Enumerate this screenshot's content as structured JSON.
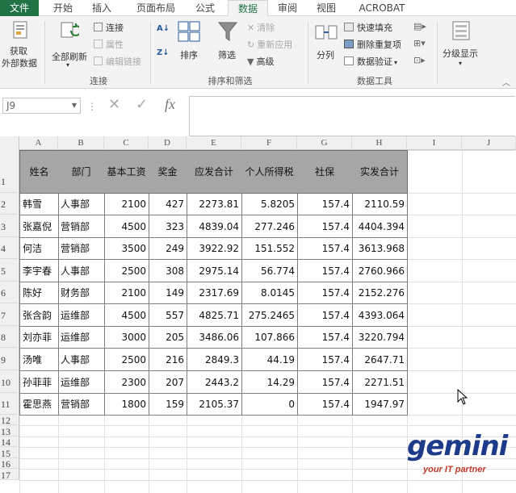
{
  "tabs": [
    {
      "label": "文件"
    },
    {
      "label": "开始"
    },
    {
      "label": "插入"
    },
    {
      "label": "页面布局"
    },
    {
      "label": "公式"
    },
    {
      "label": "数据"
    },
    {
      "label": "审阅"
    },
    {
      "label": "视图"
    },
    {
      "label": "ACROBAT"
    }
  ],
  "active_tab": "数据",
  "ribbon": {
    "get_external": {
      "line1": "获取",
      "line2": "外部数据"
    },
    "refresh_all": "全部刷新",
    "connections": "连接",
    "properties": "属性",
    "edit_links": "编辑链接",
    "group_connections": "连接",
    "sort": "排序",
    "filter": "筛选",
    "clear": "清除",
    "reapply": "重新应用",
    "advanced": "高级",
    "group_sort_filter": "排序和筛选",
    "text_to_columns": "分列",
    "flash_fill": "快速填充",
    "remove_duplicates": "删除重复项",
    "data_validation": "数据验证",
    "group_data_tools": "数据工具",
    "outline": "分级显示"
  },
  "formula_bar": {
    "name_box": "J9",
    "formula": ""
  },
  "columns": [
    "A",
    "B",
    "C",
    "D",
    "E",
    "F",
    "G",
    "H",
    "I",
    "J"
  ],
  "rows": [
    "1",
    "2",
    "3",
    "4",
    "5",
    "6",
    "7",
    "8",
    "9",
    "10",
    "11",
    "12",
    "13",
    "14",
    "15",
    "16",
    "17"
  ],
  "table": {
    "headers": [
      "姓名",
      "部门",
      "基本工资",
      "奖金",
      "应发合计",
      "个人所得税",
      "社保",
      "实发合计"
    ],
    "rows": [
      [
        "韩雪",
        "人事部",
        "2100",
        "427",
        "2273.81",
        "5.8205",
        "157.4",
        "2110.59"
      ],
      [
        "张嘉倪",
        "营销部",
        "4500",
        "323",
        "4839.04",
        "277.246",
        "157.4",
        "4404.394"
      ],
      [
        "何洁",
        "营销部",
        "3500",
        "249",
        "3922.92",
        "151.552",
        "157.4",
        "3613.968"
      ],
      [
        "李宇春",
        "人事部",
        "2500",
        "308",
        "2975.14",
        "56.774",
        "157.4",
        "2760.966"
      ],
      [
        "陈好",
        "财务部",
        "2100",
        "149",
        "2317.69",
        "8.0145",
        "157.4",
        "2152.276"
      ],
      [
        "张含韵",
        "运维部",
        "4500",
        "557",
        "4825.71",
        "275.2465",
        "157.4",
        "4393.064"
      ],
      [
        "刘亦菲",
        "运维部",
        "3000",
        "205",
        "3486.06",
        "107.866",
        "157.4",
        "3220.794"
      ],
      [
        "汤唯",
        "人事部",
        "2500",
        "216",
        "2849.3",
        "44.19",
        "157.4",
        "2647.71"
      ],
      [
        "孙菲菲",
        "运维部",
        "2300",
        "207",
        "2443.2",
        "14.29",
        "157.4",
        "2271.51"
      ],
      [
        "霍思燕",
        "营销部",
        "1800",
        "159",
        "2105.37",
        "0",
        "157.4",
        "1947.97"
      ]
    ]
  },
  "logo": {
    "word": "gemini",
    "tagline": "your IT partner"
  },
  "colors": {
    "accent": "#217346",
    "header_fill": "#a6a6a6",
    "logo_blue": "#1e3a8a",
    "logo_red": "#c0392b"
  }
}
